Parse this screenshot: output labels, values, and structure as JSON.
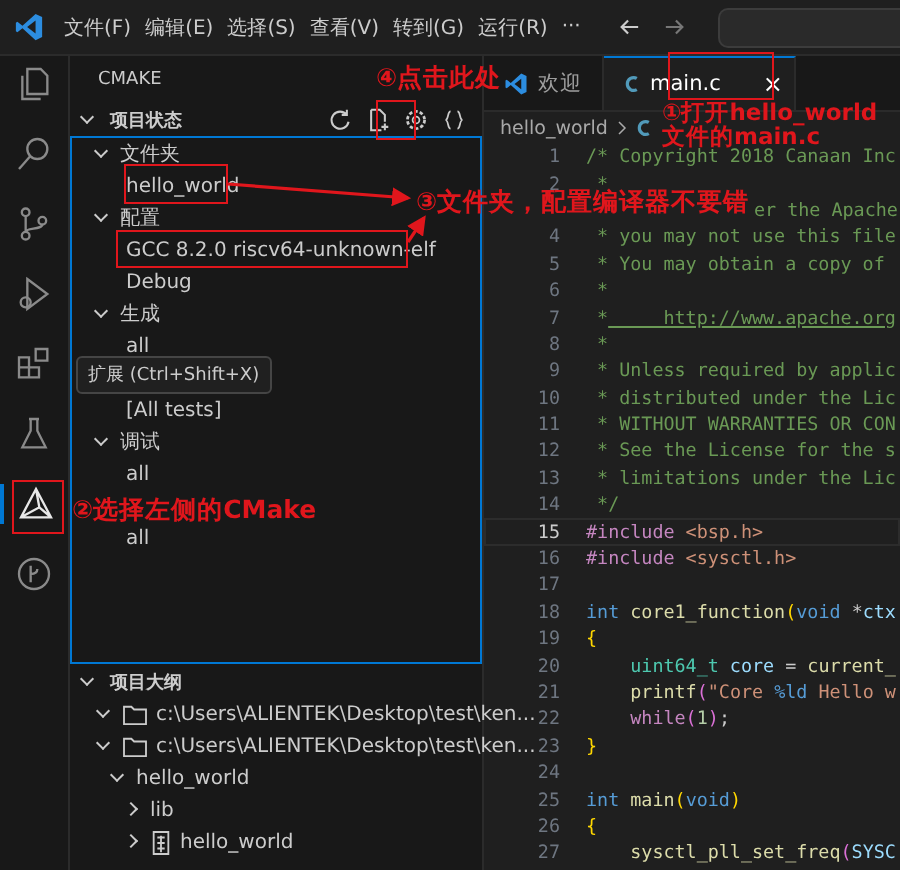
{
  "menu": [
    "文件(F)",
    "编辑(E)",
    "选择(S)",
    "查看(V)",
    "转到(G)",
    "运行(R)",
    "···"
  ],
  "activity": [
    {
      "kind": "files",
      "selected": false
    },
    {
      "kind": "search",
      "selected": false
    },
    {
      "kind": "scm",
      "selected": false
    },
    {
      "kind": "run",
      "selected": false
    },
    {
      "kind": "extensions",
      "selected": false
    },
    {
      "kind": "testing",
      "selected": false
    },
    {
      "kind": "cmake",
      "selected": true
    },
    {
      "kind": "branch",
      "selected": false
    }
  ],
  "tooltip": "扩展 (Ctrl+Shift+X)",
  "sidebar": {
    "title": "CMAKE",
    "status": {
      "title": "项目状态",
      "expanded": true,
      "sections": [
        {
          "label": "文件夹",
          "expanded": true,
          "children": [
            "hello_world"
          ]
        },
        {
          "label": "配置",
          "expanded": true,
          "children": [
            "GCC 8.2.0 riscv64-unknown-elf",
            "Debug"
          ]
        },
        {
          "label": "生成",
          "expanded": true,
          "children": [
            "all"
          ]
        },
        {
          "expanded": true,
          "children": [
            "[All tests]"
          ]
        },
        {
          "label": "调试",
          "expanded": true,
          "children": [
            "all"
          ]
        },
        {
          "expanded": true,
          "children": [
            "all"
          ]
        }
      ]
    },
    "outline": {
      "title": "项目大纲",
      "expanded": true,
      "items": [
        {
          "label": "c:\\Users\\ALIENTEK\\Desktop\\test\\ken...",
          "kind": "folder",
          "expanded": true
        },
        {
          "label": "c:\\Users\\ALIENTEK\\Desktop\\test\\ken...",
          "kind": "folder",
          "expanded": true,
          "children": [
            {
              "label": "hello_world",
              "expanded": true,
              "children": [
                {
                  "label": "lib",
                  "expanded": false
                },
                {
                  "label": "hello_world",
                  "kind": "executable",
                  "expanded": false
                }
              ]
            }
          ]
        }
      ]
    }
  },
  "tabs": [
    {
      "label": "欢迎",
      "kind": "welcome",
      "selected": false
    },
    {
      "label": "main.c",
      "kind": "c",
      "selected": true,
      "close": "×"
    }
  ],
  "breadcrumb": "hello_world",
  "code": [
    {
      "n": "1",
      "active": false,
      "tokens": [
        {
          "kind": "comment",
          "text": "/* Copyright 2018 Canaan Inc"
        }
      ]
    },
    {
      "n": "2",
      "active": false,
      "tokens": [
        {
          "kind": "comment",
          "text": " *"
        }
      ]
    },
    {
      "active": false,
      "covered": true,
      "tokens": [
        {
          "kind": "comment",
          "text": "er the Apache"
        }
      ]
    },
    {
      "n": "4",
      "active": false,
      "tokens": [
        {
          "kind": "comment",
          "text": " * you may not use this file"
        }
      ]
    },
    {
      "n": "5",
      "active": false,
      "tokens": [
        {
          "kind": "comment",
          "text": " * You may obtain a copy of"
        }
      ]
    },
    {
      "n": "6",
      "active": false,
      "tokens": [
        {
          "kind": "comment",
          "text": " *"
        }
      ]
    },
    {
      "n": "7",
      "active": false,
      "tokens": [
        {
          "kind": "comment",
          "text": " *"
        },
        {
          "kind": "link",
          "text": "     http://www.apache.org"
        }
      ]
    },
    {
      "n": "8",
      "active": false,
      "tokens": [
        {
          "kind": "comment",
          "text": " *"
        }
      ]
    },
    {
      "n": "9",
      "active": false,
      "tokens": [
        {
          "kind": "comment",
          "text": " * Unless required by applic"
        }
      ]
    },
    {
      "n": "10",
      "active": false,
      "tokens": [
        {
          "kind": "comment",
          "text": " * distributed under the Lic"
        }
      ]
    },
    {
      "n": "11",
      "active": false,
      "tokens": [
        {
          "kind": "comment",
          "text": " * WITHOUT WARRANTIES OR CON"
        }
      ]
    },
    {
      "n": "12",
      "active": false,
      "tokens": [
        {
          "kind": "comment",
          "text": " * See the License for the s"
        }
      ]
    },
    {
      "n": "13",
      "active": false,
      "tokens": [
        {
          "kind": "comment",
          "text": " * limitations under the Lic"
        }
      ]
    },
    {
      "n": "14",
      "active": false,
      "tokens": [
        {
          "kind": "comment",
          "text": " */"
        }
      ]
    },
    {
      "n": "15",
      "active": true,
      "tokens": [
        {
          "kind": "preproc",
          "text": "#include"
        },
        {
          "kind": "string",
          "text": " <bsp.h>"
        }
      ]
    },
    {
      "n": "16",
      "active": false,
      "tokens": [
        {
          "kind": "preproc",
          "text": "#include"
        },
        {
          "kind": "string",
          "text": " <sysctl.h>"
        }
      ]
    },
    {
      "n": "17",
      "active": false
    },
    {
      "n": "18",
      "active": false,
      "tokens": [
        {
          "kind": "keyword",
          "text": "int"
        },
        {
          "kind": "function",
          "text": " core1_function"
        },
        {
          "kind": "bracket",
          "text": "("
        },
        {
          "kind": "keyword",
          "text": "void"
        },
        {
          "kind": "plain",
          "text": " *"
        },
        {
          "kind": "variable",
          "text": "ctx"
        }
      ]
    },
    {
      "n": "19",
      "active": false,
      "tokens": [
        {
          "kind": "bracket",
          "text": "{"
        }
      ]
    },
    {
      "n": "20",
      "active": false,
      "tokens": [
        {
          "kind": "type",
          "text": "    uint64_t"
        },
        {
          "kind": "variable",
          "text": " core"
        },
        {
          "kind": "plain",
          "text": " ="
        },
        {
          "kind": "function",
          "text": " current_"
        }
      ]
    },
    {
      "n": "21",
      "active": false,
      "tokens": [
        {
          "kind": "function",
          "text": "    printf"
        },
        {
          "kind": "bracket2",
          "text": "("
        },
        {
          "kind": "string",
          "text": "\"Core "
        },
        {
          "kind": "keyword",
          "text": "%ld"
        },
        {
          "kind": "string",
          "text": " Hello w"
        }
      ]
    },
    {
      "n": "22",
      "active": false,
      "tokens": [
        {
          "kind": "preproc",
          "text": "    while"
        },
        {
          "kind": "bracket2",
          "text": "("
        },
        {
          "kind": "number",
          "text": "1"
        },
        {
          "kind": "bracket2",
          "text": ")"
        },
        {
          "kind": "plain",
          "text": ";"
        }
      ]
    },
    {
      "n": "23",
      "active": false,
      "tokens": [
        {
          "kind": "bracket",
          "text": "}"
        }
      ]
    },
    {
      "n": "24",
      "active": false
    },
    {
      "n": "25",
      "active": false,
      "tokens": [
        {
          "kind": "keyword",
          "text": "int"
        },
        {
          "kind": "function",
          "text": " main"
        },
        {
          "kind": "bracket",
          "text": "("
        },
        {
          "kind": "keyword",
          "text": "void"
        },
        {
          "kind": "bracket",
          "text": ")"
        }
      ]
    },
    {
      "n": "26",
      "active": false,
      "tokens": [
        {
          "kind": "bracket",
          "text": "{"
        }
      ]
    },
    {
      "n": "27",
      "active": false,
      "tokens": [
        {
          "kind": "function",
          "text": "    sysctl_pll_set_freq"
        },
        {
          "kind": "bracket2",
          "text": "("
        },
        {
          "kind": "variable",
          "text": "SYSC"
        }
      ]
    }
  ],
  "annotations": [
    {
      "text": "④点击此处"
    },
    {
      "text": "①打开hello_world文件的main.c"
    },
    {
      "text": "③文件夹，配置编译器不要错"
    },
    {
      "text": "②选择左侧的CMake"
    }
  ]
}
